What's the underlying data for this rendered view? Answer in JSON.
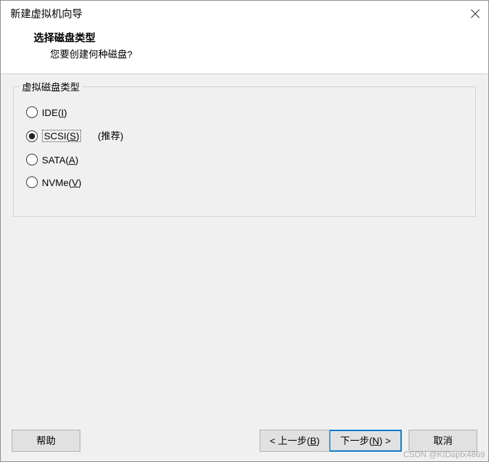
{
  "title": "新建虚拟机向导",
  "header": {
    "heading": "选择磁盘类型",
    "subtext": "您要创建何种磁盘?"
  },
  "group": {
    "legend": "虚拟磁盘类型",
    "options": [
      {
        "pre": "IDE(",
        "u": "I",
        "post": ")",
        "selected": false,
        "hint": ""
      },
      {
        "pre": "SCSI(",
        "u": "S",
        "post": ")",
        "selected": true,
        "hint": "(推荐)"
      },
      {
        "pre": "SATA(",
        "u": "A",
        "post": ")",
        "selected": false,
        "hint": ""
      },
      {
        "pre": "NVMe(",
        "u": "V",
        "post": ")",
        "selected": false,
        "hint": ""
      }
    ]
  },
  "buttons": {
    "help": "帮助",
    "back_pre": "< 上一步(",
    "back_u": "B",
    "back_post": ")",
    "next_pre": "下一步(",
    "next_u": "N",
    "next_post": ") >",
    "cancel": "取消"
  },
  "watermark": "CSDN @KIDaptx4869"
}
